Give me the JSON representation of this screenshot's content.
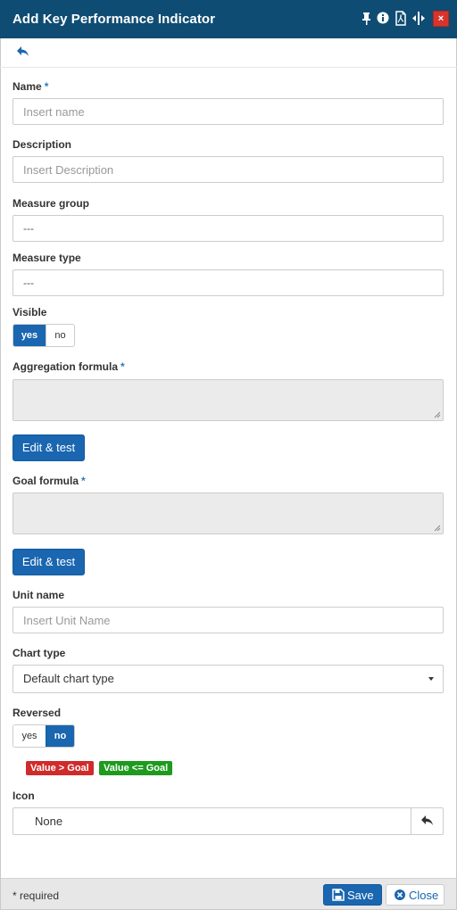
{
  "titlebar": {
    "title": "Add Key Performance Indicator",
    "icons": [
      "pin-icon",
      "info-icon",
      "pdf-icon",
      "resize-icon",
      "close-icon"
    ],
    "close_glyph": "×"
  },
  "toolbar": {
    "back_icon": "reply-icon"
  },
  "form": {
    "name": {
      "label": "Name",
      "required_mark": "*",
      "placeholder": "Insert name",
      "value": ""
    },
    "description": {
      "label": "Description",
      "placeholder": "Insert Description",
      "value": ""
    },
    "measure_group": {
      "label": "Measure group",
      "value": "---"
    },
    "measure_type": {
      "label": "Measure type",
      "value": "---"
    },
    "visible": {
      "label": "Visible",
      "options": [
        "yes",
        "no"
      ],
      "selected": "yes"
    },
    "aggregation_formula": {
      "label": "Aggregation formula",
      "required_mark": "*",
      "value": "",
      "edit_button": "Edit & test"
    },
    "goal_formula": {
      "label": "Goal formula",
      "required_mark": "*",
      "value": "",
      "edit_button": "Edit & test"
    },
    "unit_name": {
      "label": "Unit name",
      "placeholder": "Insert Unit Name",
      "value": ""
    },
    "chart_type": {
      "label": "Chart type",
      "value": "Default chart type"
    },
    "reversed": {
      "label": "Reversed",
      "options": [
        "yes",
        "no"
      ],
      "selected": "no",
      "badges": [
        {
          "text": "Value > Goal",
          "color": "#d02b2b"
        },
        {
          "text": "Value <= Goal",
          "color": "#1e9a1e"
        }
      ]
    },
    "icon": {
      "label": "Icon",
      "value": "None",
      "reset_icon": "reply-icon"
    }
  },
  "footer": {
    "required_note": "* required",
    "save_label": "Save",
    "close_label": "Close"
  },
  "colors": {
    "titlebar_bg": "#0f4c73",
    "primary": "#1a66b0",
    "close_red": "#d9342b",
    "required_asterisk": "#2b7bbd",
    "readonly_bg": "#ebebeb",
    "footer_bg": "#e7e7e7"
  }
}
